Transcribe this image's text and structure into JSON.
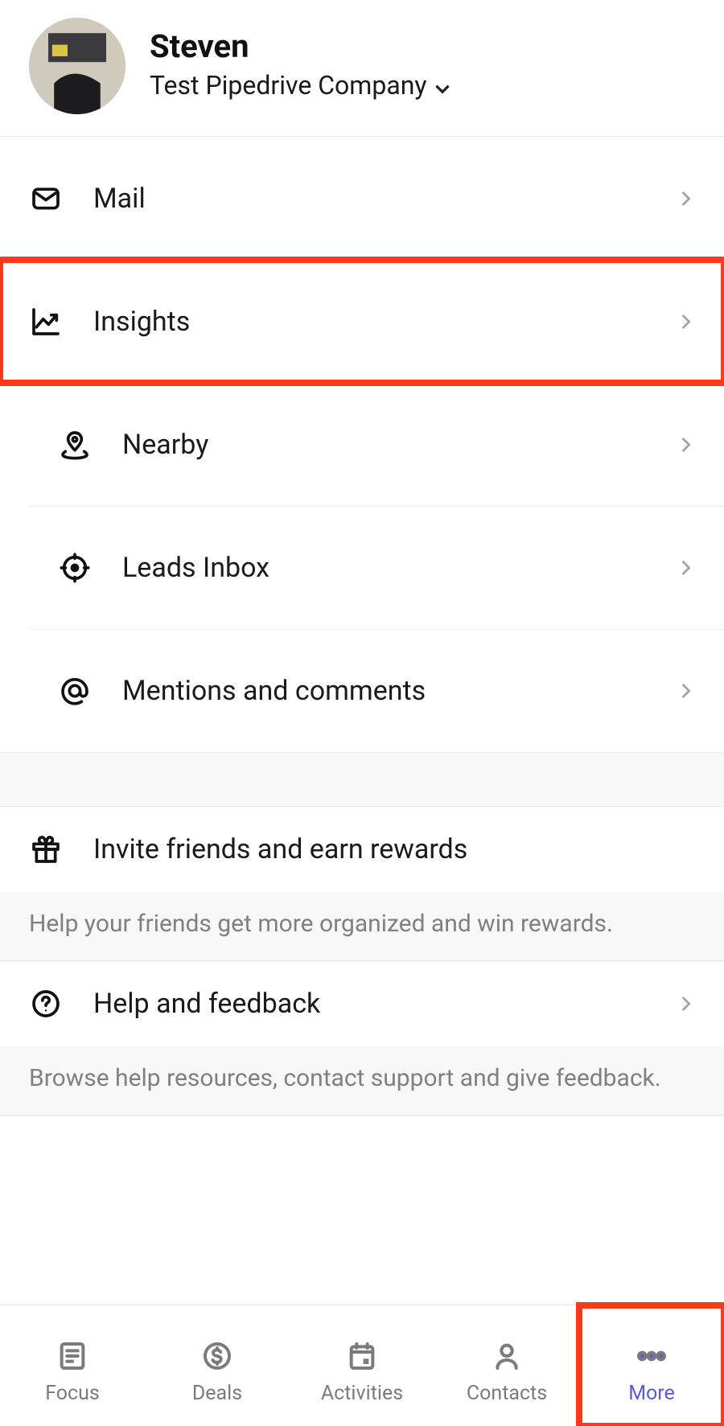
{
  "header": {
    "user_name": "Steven",
    "company": "Test Pipedrive Company"
  },
  "menu": {
    "primary": [
      {
        "icon": "mail-icon",
        "name": "menu-item-mail",
        "label": "Mail"
      },
      {
        "icon": "insights-icon",
        "name": "menu-item-insights",
        "label": "Insights",
        "highlight": true
      },
      {
        "icon": "nearby-icon",
        "name": "menu-item-nearby",
        "label": "Nearby"
      },
      {
        "icon": "leads-icon",
        "name": "menu-item-leads",
        "label": "Leads Inbox"
      },
      {
        "icon": "mentions-icon",
        "name": "menu-item-mentions",
        "label": "Mentions and comments"
      }
    ],
    "invite": {
      "icon": "gift-icon",
      "name": "menu-item-invite",
      "label": "Invite friends and earn rewards",
      "subtext": "Help your friends get more organized and win rewards."
    },
    "help": {
      "icon": "help-icon",
      "name": "menu-item-help",
      "label": "Help and feedback",
      "subtext": "Browse help resources, contact support and give feedback."
    }
  },
  "nav": [
    {
      "icon": "focus-icon",
      "name": "tab-focus",
      "label": "Focus"
    },
    {
      "icon": "deals-icon",
      "name": "tab-deals",
      "label": "Deals"
    },
    {
      "icon": "activities-icon",
      "name": "tab-activities",
      "label": "Activities"
    },
    {
      "icon": "contacts-icon",
      "name": "tab-contacts",
      "label": "Contacts"
    },
    {
      "icon": "more-icon",
      "name": "tab-more",
      "label": "More",
      "active": true,
      "highlight": true
    }
  ]
}
